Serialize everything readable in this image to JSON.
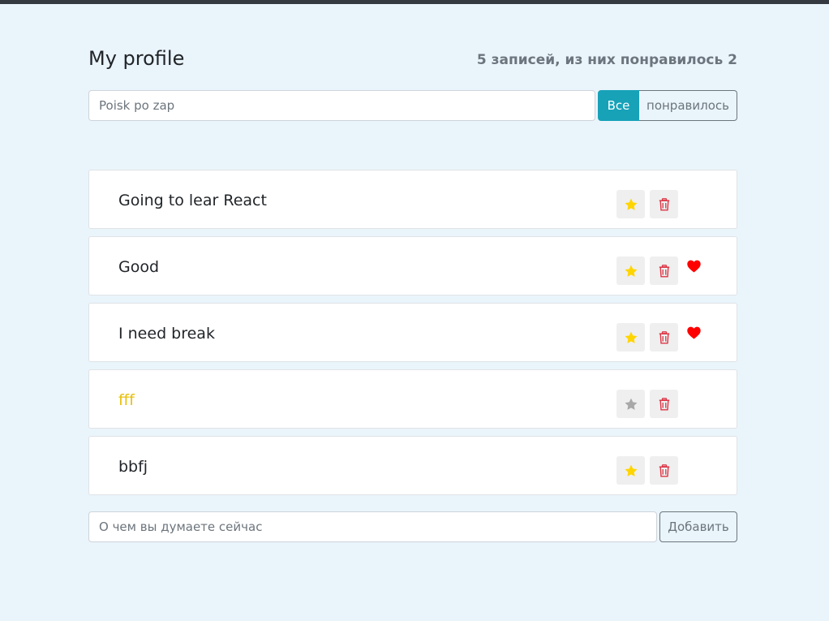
{
  "header": {
    "title": "My profile",
    "counter": "5 записей, из них понравилось 2"
  },
  "search": {
    "placeholder": "Poisk po zap",
    "value": ""
  },
  "filters": [
    {
      "label": "Все",
      "active": true
    },
    {
      "label": "понравилось",
      "active": false
    }
  ],
  "posts": [
    {
      "label": "Going to lear React",
      "important": false,
      "liked": false
    },
    {
      "label": "Good",
      "important": false,
      "liked": true
    },
    {
      "label": "I need break",
      "important": false,
      "liked": true
    },
    {
      "label": "fff",
      "important": true,
      "liked": false
    },
    {
      "label": "bbfj",
      "important": false,
      "liked": false
    }
  ],
  "add_form": {
    "placeholder": "О чем вы думаете сейчас",
    "value": "",
    "button_label": "Добавить"
  },
  "icons": {
    "star": "star-icon",
    "trash": "trash-icon",
    "heart": "heart-icon"
  },
  "colors": {
    "background": "#eaf4fb",
    "accent": "#17a2b8",
    "star_active": "#ffd500",
    "star_inactive": "#a8a8a8",
    "trash": "#dc3545",
    "heart": "#ff0000",
    "important_text": "#e8c10d"
  }
}
